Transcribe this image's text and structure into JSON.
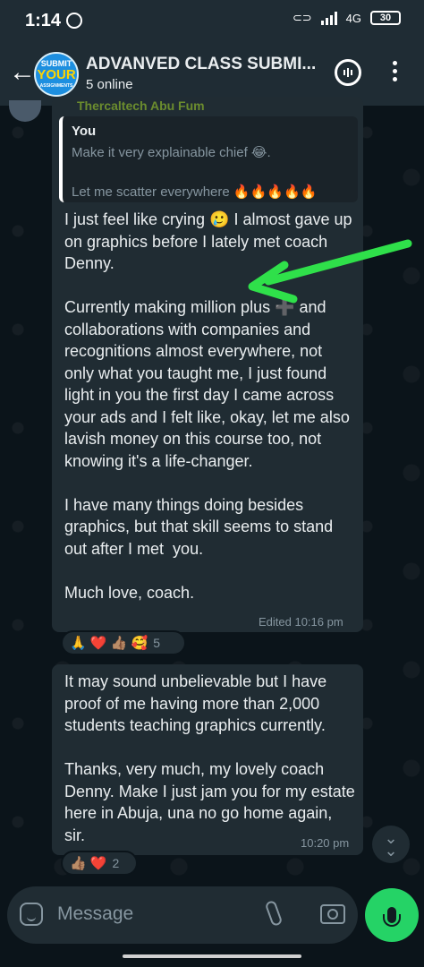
{
  "status_bar": {
    "time": "1:14",
    "network": "4G",
    "battery": "30"
  },
  "header": {
    "back_icon": "arrow-left-icon",
    "avatar_text": [
      "SUBMIT",
      "YOUR",
      "ASSIGNMENTS"
    ],
    "title": "ADVANVED CLASS SUBMI...",
    "subtitle": "5 online"
  },
  "messages": [
    {
      "partial_sender": "Thercaltech Abu Fum",
      "quote": {
        "author": "You",
        "line1": "Make it very explainable chief 😂.",
        "line2": "Let me scatter everywhere 🔥🔥🔥🔥🔥"
      },
      "text": "I just feel like crying 🥲 I almost gave up on graphics before I lately met coach Denny.\n\nCurrently making million plus ➕ and collaborations with companies and recognitions almost everywhere, not only what you taught me, I just found light in you the first day I came across your ads and I felt like, okay, let me also lavish money on this course too, not knowing it's a life-changer.\n\nI have many things doing besides graphics, but that skill seems to stand out after I met  you.\n\nMuch love, coach.",
      "meta": "Edited 10:16 pm",
      "reactions": "🙏 ❤️ 👍🏽 🥰",
      "reaction_count": "5"
    },
    {
      "text": "It may sound unbelievable but I have proof of me having more than 2,000 students teaching graphics currently.\n\nThanks, very much, my lovely coach Denny. Make I just jam you for my estate here in Abuja, una no go home again, sir.",
      "meta": "10:20 pm",
      "reactions": "👍🏽 ❤️",
      "reaction_count": "2"
    }
  ],
  "composer": {
    "placeholder": "Message"
  },
  "colors": {
    "accent": "#25d366",
    "bubble": "#202c33",
    "header": "#1f2c34",
    "arrow": "#2fe04a"
  }
}
